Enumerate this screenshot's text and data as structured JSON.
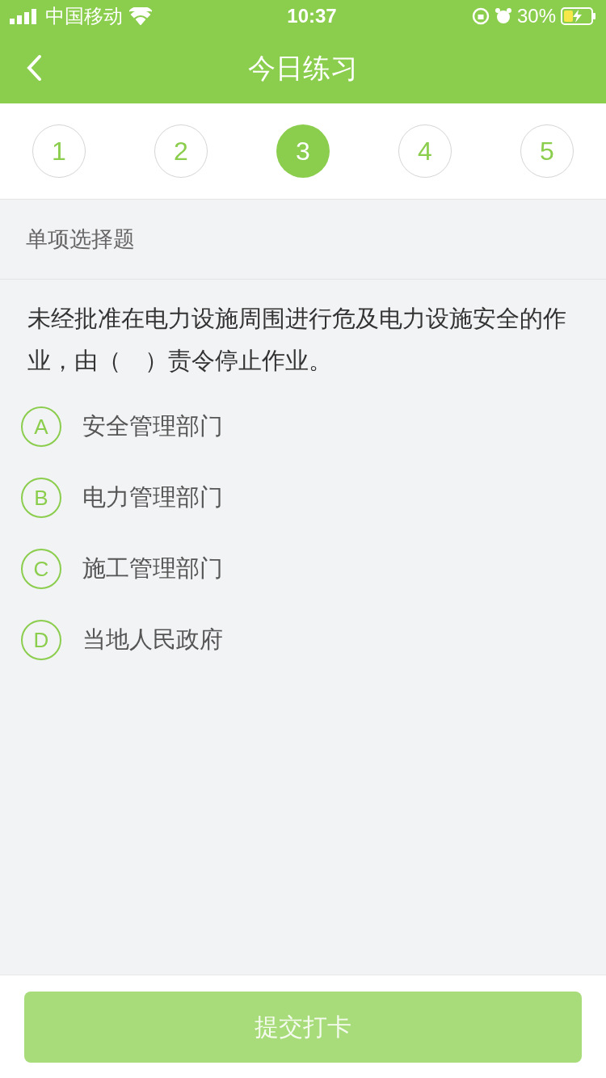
{
  "status_bar": {
    "carrier": "中国移动",
    "time": "10:37",
    "battery": "30%"
  },
  "nav": {
    "title": "今日练习"
  },
  "steps": [
    {
      "label": "1",
      "selected": false
    },
    {
      "label": "2",
      "selected": false
    },
    {
      "label": "3",
      "selected": true
    },
    {
      "label": "4",
      "selected": false
    },
    {
      "label": "5",
      "selected": false
    }
  ],
  "section_label": "单项选择题",
  "question": "未经批准在电力设施周围进行危及电力设施安全的作业，由（　）责令停止作业。",
  "options": [
    {
      "letter": "A",
      "text": "安全管理部门",
      "selected": false
    },
    {
      "letter": "B",
      "text": "电力管理部门",
      "selected": false
    },
    {
      "letter": "C",
      "text": "施工管理部门",
      "selected": false
    },
    {
      "letter": "D",
      "text": "当地人民政府",
      "selected": false
    }
  ],
  "submit": {
    "label": "提交打卡",
    "disabled": true
  }
}
